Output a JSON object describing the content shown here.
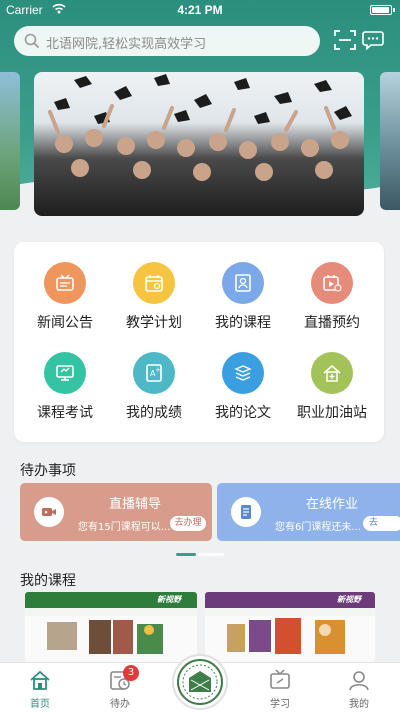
{
  "status_bar": {
    "carrier": "Carrier",
    "time": "4:21 PM"
  },
  "search": {
    "placeholder": "北语网院,轻松实现高效学习"
  },
  "menu": [
    {
      "label": "新闻公告",
      "icon": "news-icon",
      "color": "#f0955c"
    },
    {
      "label": "教学计划",
      "icon": "calendar-icon",
      "color": "#f5c542"
    },
    {
      "label": "我的课程",
      "icon": "course-book-icon",
      "color": "#7aa8e8"
    },
    {
      "label": "直播预约",
      "icon": "live-calendar-icon",
      "color": "#e68a7a"
    },
    {
      "label": "课程考试",
      "icon": "exam-monitor-icon",
      "color": "#35c4a3"
    },
    {
      "label": "我的成绩",
      "icon": "score-icon",
      "color": "#4fb8c6"
    },
    {
      "label": "我的论文",
      "icon": "paper-stack-icon",
      "color": "#3a9fe0"
    },
    {
      "label": "职业加油站",
      "icon": "career-house-icon",
      "color": "#a3c35a"
    }
  ],
  "todo": {
    "title": "待办事项",
    "cards": [
      {
        "title": "直播辅导",
        "subtitle": "您有15门课程可以...",
        "action": "去办理",
        "color": "#d89c8c",
        "accent": "#c26a5c"
      },
      {
        "title": "在线作业",
        "subtitle": "您有6门课程还未...",
        "action": "去",
        "color": "#8fb2ea",
        "accent": "#5a86d6"
      }
    ]
  },
  "courses": {
    "title": "我的课程",
    "items": [
      {
        "header_color": "#2f7d3d",
        "tag": "新视野"
      },
      {
        "header_color": "#6b3b7a",
        "tag": "新视野"
      }
    ]
  },
  "tabbar": {
    "tabs": [
      {
        "label": "首页",
        "icon": "home-icon",
        "active": true
      },
      {
        "label": "待办",
        "icon": "todo-clock-icon",
        "badge": "3"
      },
      {
        "label": "学习",
        "icon": "tv-icon"
      },
      {
        "label": "我的",
        "icon": "profile-icon"
      }
    ]
  }
}
